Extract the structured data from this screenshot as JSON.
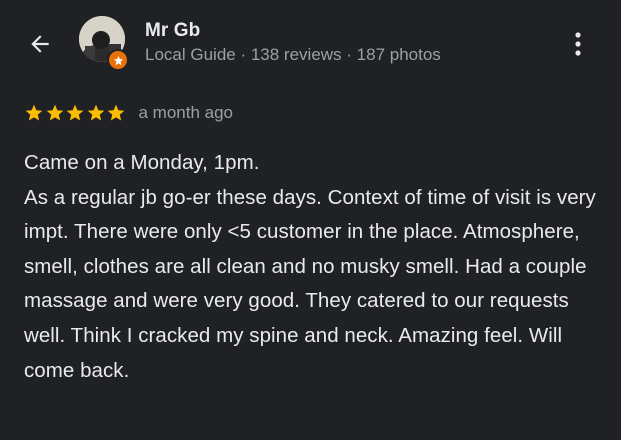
{
  "header": {
    "back_icon": "arrow-back-icon",
    "menu_icon": "more-vert-icon",
    "reviewer": {
      "name": "Mr Gb",
      "meta": "Local Guide · 138 reviews · 187 photos",
      "avatar_icon": "avatar-photo",
      "badge_icon": "local-guide-star-icon",
      "badge_color": "#e8710a"
    }
  },
  "review": {
    "rating": 5,
    "rating_max": 5,
    "star_color": "#fbbc04",
    "date": "a month ago",
    "text": "Came on a Monday, 1pm.\nAs a regular jb go-er these days. Context of time of visit is very impt. There were only <5 customer in the place. Atmosphere, smell, clothes are all clean and no musky smell. Had a couple massage and were very good. They catered to our requests well. Think I cracked my spine and neck. Amazing feel. Will come back."
  },
  "colors": {
    "background": "#202124",
    "primary_text": "#e8eaed",
    "secondary_text": "#9aa0a6"
  }
}
